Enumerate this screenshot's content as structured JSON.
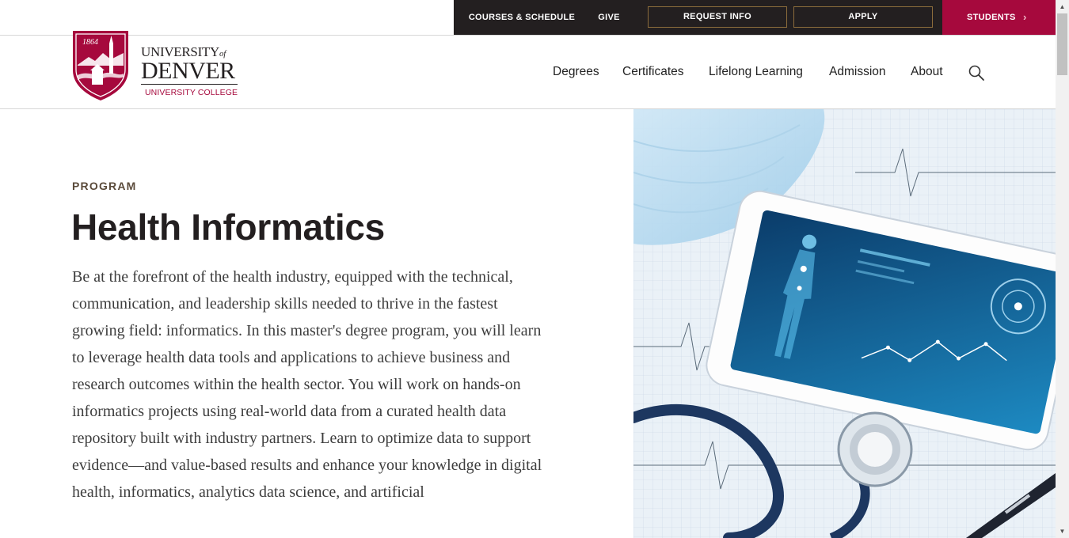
{
  "utility": {
    "courses": "COURSES & SCHEDULE",
    "give": "GIVE",
    "request_info": "REQUEST INFO",
    "apply": "APPLY",
    "students": "STUDENTS"
  },
  "brand": {
    "crest_year": "1864",
    "university_line1": "UNIVERSITY",
    "university_of": "of",
    "university_line2": "DENVER",
    "college": "UNIVERSITY COLLEGE",
    "crimson": "#a6093d",
    "gold": "#8c6d3c",
    "dark": "#231f20"
  },
  "nav": {
    "items": [
      "Degrees",
      "Certificates",
      "Lifelong Learning",
      "Admission",
      "About"
    ],
    "search_icon": "search-icon"
  },
  "program": {
    "eyebrow": "PROGRAM",
    "title": "Health Informatics",
    "description": "Be at the forefront of the health industry, equipped with the technical, communication, and leadership skills needed to thrive in the fastest growing field: informatics. In this master's degree program, you will learn to leverage health data tools and applications to achieve business and research outcomes within the health sector. You will work on hands-on informatics projects using real-world data from a curated health data repository built with industry partners. Learn to optimize data to support evidence—and value-based results and enhance your knowledge in digital health, informatics, analytics data science, and artificial"
  }
}
